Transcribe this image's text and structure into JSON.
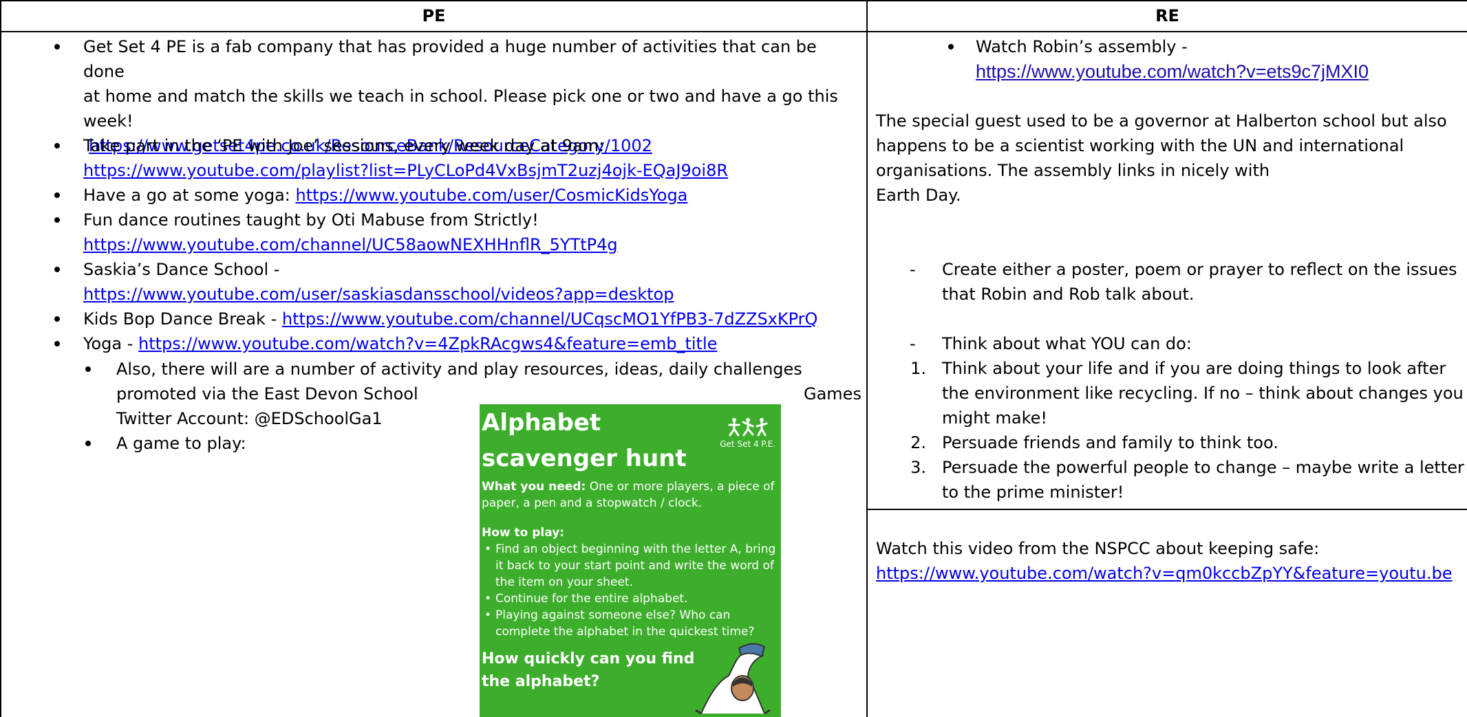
{
  "headers": {
    "pe": "PE",
    "re": "RE"
  },
  "pe": {
    "item1": {
      "lines": [
        "Get Set 4 PE is a fab company that has provided a huge number of activities that can be done",
        "at home and match the skills we teach in school. Please pick one or two and have a go this",
        "week!"
      ],
      "link": "https://www.getset4pe.co.uk/ResourceBank/ResourceCategory/1002"
    },
    "item2": {
      "text": "Take part in the ‘PE with Joe’ sessions, every week day at 9am:",
      "link": "https://www.youtube.com/playlist?list=PLyCLoPd4VxBsjmT2uzj4ojk-EQaJ9oi8R"
    },
    "item3": {
      "text": "Have a go at some yoga: ",
      "link": "https://www.youtube.com/user/CosmicKidsYoga"
    },
    "item4": {
      "text": "Fun dance routines taught by Oti Mabuse from Strictly!",
      "link": "https://www.youtube.com/channel/UC58aowNEXHHnflR_5YTtP4g"
    },
    "item5": {
      "text": "Saskia’s Dance School -",
      "link": "https://www.youtube.com/user/saskiasdansschool/videos?app=desktop"
    },
    "item6": {
      "text": "Kids Bop Dance Break - ",
      "link": "https://www.youtube.com/channel/UCqscMO1YfPB3-7dZZSxKPrQ"
    },
    "item7": {
      "text": "Yoga - ",
      "link": "https://www.youtube.com/watch?v=4ZpkRAcgws4&feature=emb_title"
    },
    "sub1": {
      "line1": " Also, there will are a number of activity and play resources, ideas, daily challenges",
      "line2a": "promoted via the East Devon School",
      "line2b": "Games",
      "line3": "Twitter Account: @EDSchoolGa1"
    },
    "sub2": {
      "text": "A game to play:"
    }
  },
  "poster": {
    "title_line1": "Alphabet",
    "title_line2": "scavenger hunt",
    "logo_text": "Get Set 4 P.E.",
    "need_label": "What you need:",
    "need_text": " One or more players, a piece of paper, a pen and a stopwatch / clock.",
    "how_label": "How to play:",
    "steps": [
      "Find an object beginning with the letter A, bring it back to your start point and write the word of the item on your sheet.",
      "Continue for the entire alphabet.",
      "Playing against someone else? Who can complete the alphabet in the quickest time?"
    ],
    "question_line1": "How quickly can you find",
    "question_line2": "the alphabet?"
  },
  "re": {
    "assembly_text": "Watch Robin’s assembly -",
    "assembly_link": "https://www.youtube.com/watch?v=ets9c7jMXI0",
    "para_lines": [
      "The special guest used to be a governor at Halberton school but also",
      "happens to be a scientist working with the UN and international",
      "organisations. The assembly links in nicely with",
      "Earth Day."
    ],
    "dash1_lines": [
      "Create either a poster, poem or prayer to reflect on the issues",
      "that Robin and Rob talk about."
    ],
    "dash2": "Think about what YOU can do:",
    "numbered": [
      {
        "num": "1.",
        "lines": [
          "Think about your life and if you are doing things to look after",
          "the environment like recycling. If no – think about changes you",
          "might make!"
        ]
      },
      {
        "num": "2.",
        "lines": [
          "Persuade friends and family to think too."
        ]
      },
      {
        "num": "3.",
        "lines": [
          "Persuade the powerful people to change – maybe write a letter",
          "to the prime minister!"
        ]
      }
    ],
    "nspcc_text": "Watch this video from the NSPCC about keeping safe:",
    "nspcc_link": "https://www.youtube.com/watch?v=qm0kccbZpYY&feature=youtu.be"
  }
}
